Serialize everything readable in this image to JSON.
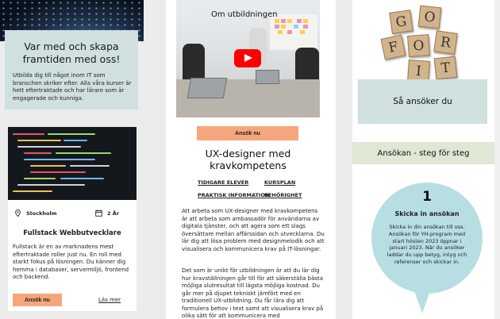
{
  "left": {
    "hero_title": "Var med och skapa framtiden med oss!",
    "hero_text": "Utbilda dig till något inom IT som branschen skriker efter. Alla våra kurser är hett eftertraktade och har lärare som är engagerade och kunniga.",
    "card": {
      "location": "Stockholm",
      "duration": "2 År",
      "title": "Fullstack Webbutvecklare",
      "text": "Fullstack är en av marknadens mest eftertraktade roller just nu. En roll med starkt fokus på lösningen. Du känner dig hemma i databaser, servermiljö, frontend och backend.",
      "apply_label": "Ansök nu",
      "more_label": "Läs mer"
    }
  },
  "middle": {
    "video_title": "Om utbildningen",
    "apply_label": "Ansök nu",
    "title": "UX-designer med kravkompetens",
    "links": [
      "TIDIGARE ELEVER",
      "KURSPLAN",
      "PRAKTISK INFORMATION",
      "BEHÖRIGHET"
    ],
    "paragraph1": "Att arbeta som UX-designer med kravkompetens är att arbeta som ambassadör för användarna av digitala tjänster, och att agera som ett slags översättare mellan affärssidan och utvecklarna. Du lär dig att lösa problem med designmelodik och att visualisera och kommunicera krav på IT-lösningar.",
    "paragraph2": "Det som är unikt för utbildningen är att du lär dig hur kravställningen går till för att säkerställa bästa möjliga slutresultat till lägsta möjliga kostnad. Du går mer på djupet tekniskt jämfört med en traditionell UX-utbildning. Du får lära dig att formulera behov i text samt att visualisera krav på olika sätt för att kommunicera med"
  },
  "right": {
    "tiles": [
      "G",
      "O",
      "F",
      "O",
      "R",
      "I",
      "T"
    ],
    "apply_title": "Så ansöker du",
    "steps_title": "Ansökan - steg för steg",
    "step": {
      "number": "1",
      "title": "Skicka in ansökan",
      "text": "Skicka in din ansökan till oss. Ansökan för YH-program med start hösten 2023 öppnar i januari 2023. När du ansöker laddar du upp betyg, intyg och referenser och skickar in."
    }
  },
  "colors": {
    "accent_orange": "#f6a67c",
    "panel_teal": "#cfe0df",
    "bubble_blue": "#b7dfe3",
    "steps_green": "#dfe7d5"
  }
}
